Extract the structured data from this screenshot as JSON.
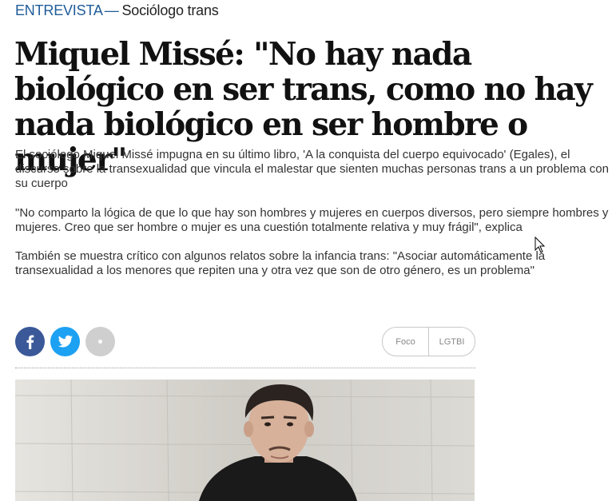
{
  "kicker": {
    "section": "ENTREVISTA",
    "separator": "—",
    "topic": "Sociólogo trans"
  },
  "headline": "Miquel Missé: \"No hay nada biológico en ser trans, como no hay nada biológico en ser hombre o mujer\"",
  "summary": [
    "El sociólogo Miquel Missé impugna en su último libro, 'A la conquista del cuerpo equivocado' (Egales), el discurso sobre la transexualidad que vincula el malestar que sienten muchas personas trans a un problema con su cuerpo",
    "\"No comparto la lógica de que lo que hay son hombres y mujeres en cuerpos diversos, pero siempre hombres y mujeres. Creo que ser hombre o mujer es una cuestión totalmente relativa y muy frágil\", explica",
    "También se muestra crítico con algunos relatos sobre la infancia trans: \"Asociar automáticamente la transexualidad a los menores que repiten una y otra vez que son de otro género, es un problema\""
  ],
  "share": {
    "facebook_icon": "facebook-icon",
    "twitter_icon": "twitter-icon",
    "more_icon": "more-options-icon"
  },
  "tags": [
    "Foco",
    "LGTBI"
  ],
  "colors": {
    "section": "#1f5c99",
    "facebook": "#3b5998",
    "twitter": "#1da1f2",
    "more": "#cfcfcf"
  },
  "photo": {
    "icon": "portrait-photo"
  }
}
